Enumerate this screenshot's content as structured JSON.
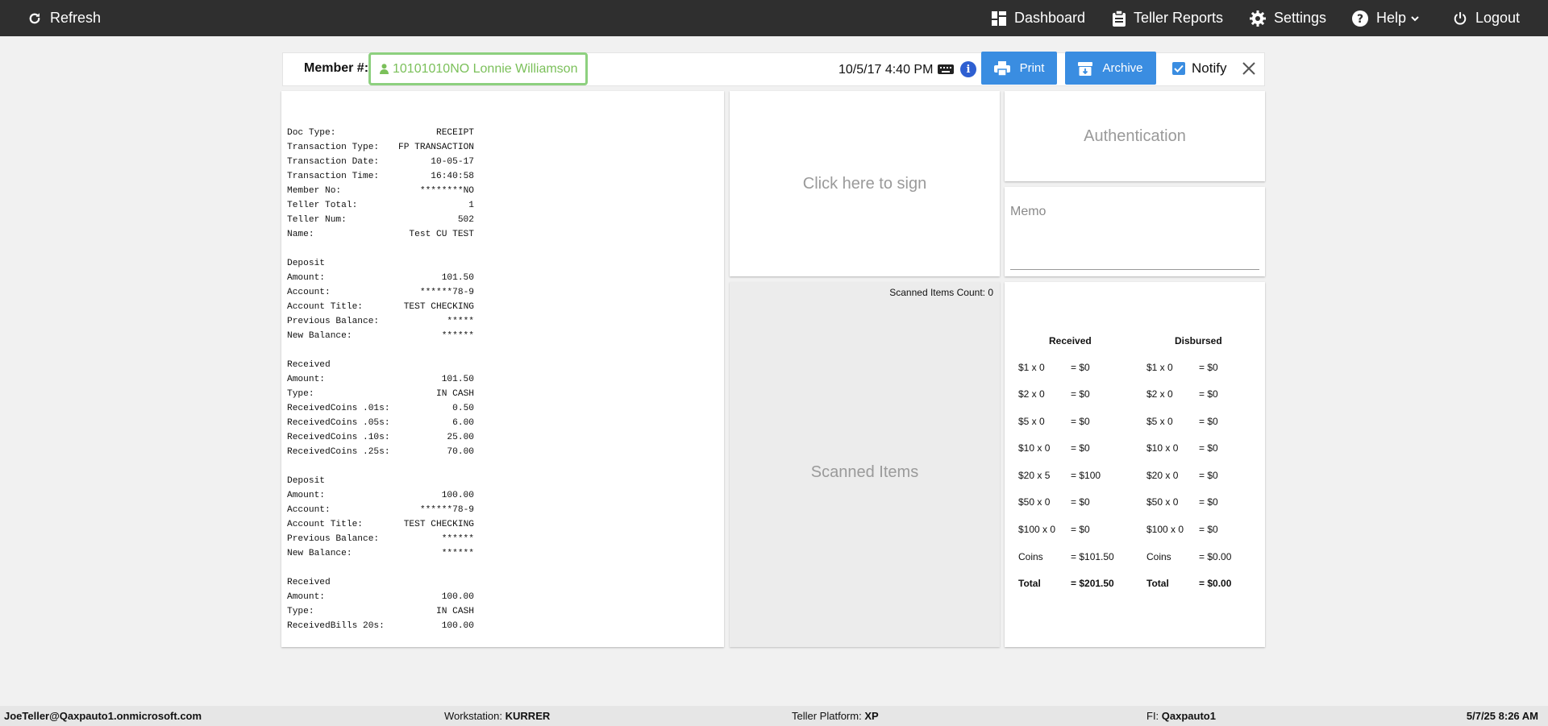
{
  "topbar": {
    "refresh": "Refresh",
    "dashboard": "Dashboard",
    "teller_reports": "Teller Reports",
    "settings": "Settings",
    "help": "Help",
    "logout": "Logout",
    "background": "#2f2f2f"
  },
  "member": {
    "label": "Member #:",
    "value": "10101010NO Lonnie Williamson",
    "datetime": "10/5/17 4:40 PM",
    "print": "Print",
    "archive": "Archive",
    "notify": "Notify",
    "notify_checked": true,
    "accent_color": "#3a8de1",
    "field_border_color": "#8dd07f"
  },
  "receipt": {
    "lines": [
      [
        "",
        ""
      ],
      [
        "Doc Type:",
        "RECEIPT"
      ],
      [
        "Transaction Type:",
        "FP TRANSACTION"
      ],
      [
        "Transaction Date:",
        "10-05-17"
      ],
      [
        "Transaction Time:",
        "16:40:58"
      ],
      [
        "Member No:",
        "********NO"
      ],
      [
        "Teller Total:",
        "1"
      ],
      [
        "Teller Num:",
        "502"
      ],
      [
        "Name:",
        "Test CU TEST"
      ],
      [
        "",
        ""
      ],
      [
        "Deposit",
        ""
      ],
      [
        "Amount:",
        "101.50"
      ],
      [
        "Account:",
        "******78-9"
      ],
      [
        "Account Title:",
        "TEST CHECKING"
      ],
      [
        "Previous Balance:",
        "*****"
      ],
      [
        "New Balance:",
        "******"
      ],
      [
        "",
        ""
      ],
      [
        "Received",
        ""
      ],
      [
        "Amount:",
        "101.50"
      ],
      [
        "Type:",
        "IN CASH"
      ],
      [
        "ReceivedCoins .01s:",
        "0.50"
      ],
      [
        "ReceivedCoins .05s:",
        "6.00"
      ],
      [
        "ReceivedCoins .10s:",
        "25.00"
      ],
      [
        "ReceivedCoins .25s:",
        "70.00"
      ],
      [
        "",
        ""
      ],
      [
        "Deposit",
        ""
      ],
      [
        "Amount:",
        "100.00"
      ],
      [
        "Account:",
        "******78-9"
      ],
      [
        "Account Title:",
        "TEST CHECKING"
      ],
      [
        "Previous Balance:",
        "******"
      ],
      [
        "New Balance:",
        "******"
      ],
      [
        "",
        ""
      ],
      [
        "Received",
        ""
      ],
      [
        "Amount:",
        "100.00"
      ],
      [
        "Type:",
        "IN CASH"
      ],
      [
        "ReceivedBills 20s:",
        "100.00"
      ]
    ]
  },
  "signature": {
    "prompt": "Click here to sign"
  },
  "scanned": {
    "count_label": "Scanned Items Count: 0",
    "title": "Scanned Items"
  },
  "authentication": {
    "title": "Authentication"
  },
  "memo": {
    "label": "Memo"
  },
  "cash": {
    "received_header": "Received",
    "disbursed_header": "Disbursed",
    "rows": [
      {
        "r_label": "$1 x 0",
        "r_value": "= $0",
        "d_label": "$1 x 0",
        "d_value": "= $0",
        "bold": false
      },
      {
        "r_label": "$2 x 0",
        "r_value": "= $0",
        "d_label": "$2 x 0",
        "d_value": "= $0",
        "bold": false
      },
      {
        "r_label": "$5 x 0",
        "r_value": "= $0",
        "d_label": "$5 x 0",
        "d_value": "= $0",
        "bold": false
      },
      {
        "r_label": "$10 x 0",
        "r_value": "= $0",
        "d_label": "$10 x 0",
        "d_value": "= $0",
        "bold": false
      },
      {
        "r_label": "$20 x 5",
        "r_value": "= $100",
        "d_label": "$20 x 0",
        "d_value": "= $0",
        "bold": false
      },
      {
        "r_label": "$50 x 0",
        "r_value": "= $0",
        "d_label": "$50 x 0",
        "d_value": "= $0",
        "bold": false
      },
      {
        "r_label": "$100 x 0",
        "r_value": "= $0",
        "d_label": "$100 x 0",
        "d_value": "= $0",
        "bold": false
      },
      {
        "r_label": "Coins",
        "r_value": "= $101.50",
        "d_label": "Coins",
        "d_value": "= $0.00",
        "bold": false
      },
      {
        "r_label": "Total",
        "r_value": "= $201.50",
        "d_label": "Total",
        "d_value": "= $0.00",
        "bold": true
      }
    ]
  },
  "footer": {
    "user": "JoeTeller@Qaxpauto1.onmicrosoft.com",
    "workstation_label": "Workstation:",
    "workstation": "KURRER",
    "platform_label": "Teller Platform:",
    "platform": "XP",
    "fi_label": "FI:",
    "fi": "Qaxpauto1",
    "datetime": "5/7/25 8:26 AM"
  }
}
